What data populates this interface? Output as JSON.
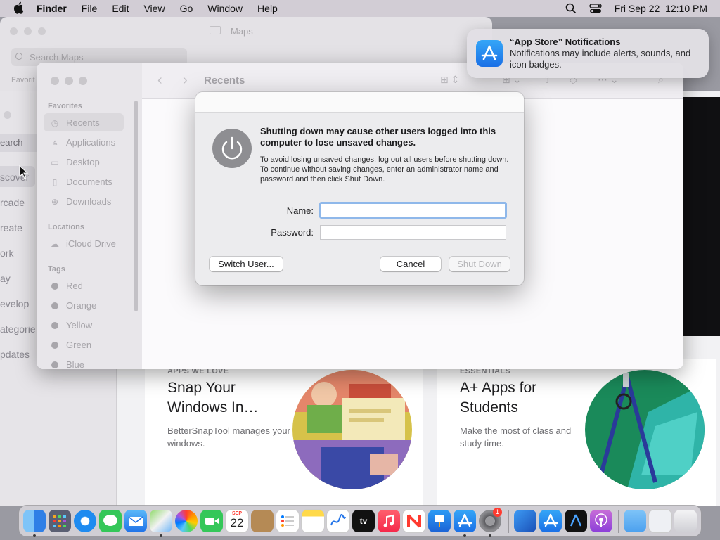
{
  "menubar": {
    "app": "Finder",
    "items": [
      "File",
      "Edit",
      "View",
      "Go",
      "Window",
      "Help"
    ],
    "datetime": "Fri Sep 22  12:10 PM"
  },
  "maps": {
    "title": "Maps",
    "search_placeholder": "Search Maps",
    "sidebar_hint": "Favorit"
  },
  "appstore": {
    "search": "earch",
    "nav": [
      "scover",
      "rcade",
      "reate",
      "ork",
      "ay",
      "evelop",
      "ategorie",
      "pdates"
    ],
    "cards": [
      {
        "kicker": "APPS WE LOVE",
        "headline": "Snap Your Windows In…",
        "sub": "BetterSnapTool manages your windows."
      },
      {
        "kicker": "ESSENTIALS",
        "headline": "A+ Apps for Students",
        "sub": "Make the most of class and study time."
      }
    ]
  },
  "finder": {
    "title": "Recents",
    "favorites_header": "Favorites",
    "favorites": [
      "Recents",
      "Applications",
      "Desktop",
      "Documents",
      "Downloads"
    ],
    "locations_header": "Locations",
    "locations": [
      "iCloud Drive"
    ],
    "tags_header": "Tags",
    "tags": [
      "Red",
      "Orange",
      "Yellow",
      "Green",
      "Blue"
    ]
  },
  "dialog": {
    "headline": "Shutting down may cause other users logged into this computer to lose unsaved changes.",
    "body": "To avoid losing unsaved changes, log out all users before shutting down. To continue without saving changes, enter an administrator name and password and then click Shut Down.",
    "name_label": "Name:",
    "password_label": "Password:",
    "name_value": "",
    "password_value": "",
    "switch_user": "Switch User...",
    "cancel": "Cancel",
    "shut_down": "Shut Down"
  },
  "notification": {
    "title": "“App Store” Notifications",
    "message": "Notifications may include alerts, sounds, and icon badges."
  },
  "dock": {
    "calendar_month": "SEP",
    "calendar_day": "22",
    "settings_badge": "1",
    "tv_label": "tv"
  }
}
